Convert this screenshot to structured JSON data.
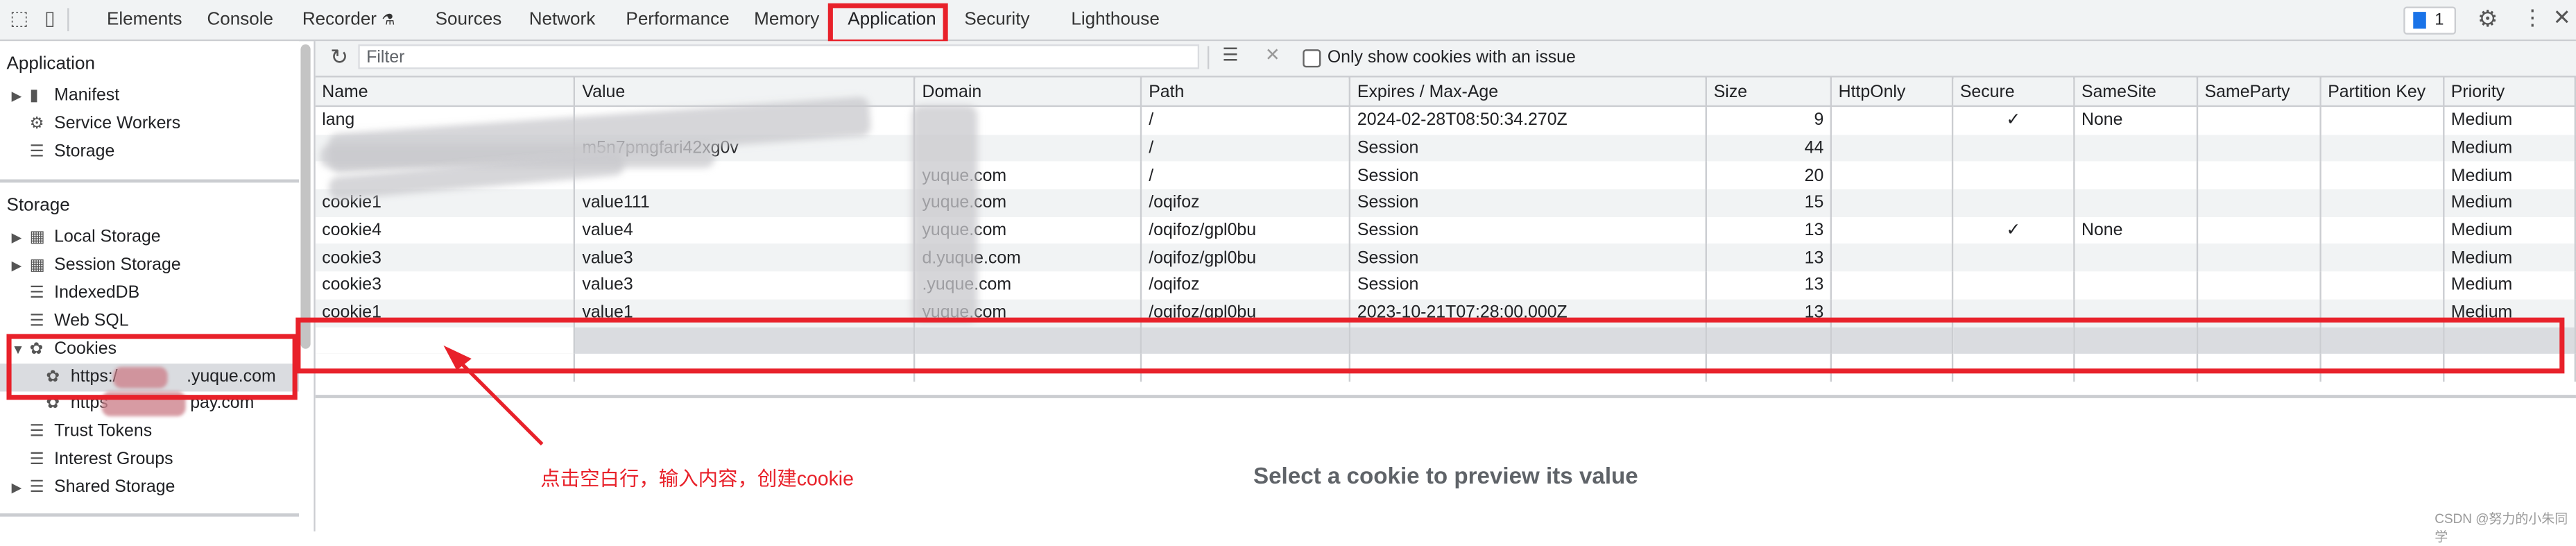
{
  "topbar": {
    "tabs": [
      "Elements",
      "Console",
      "Recorder",
      "Sources",
      "Network",
      "Performance",
      "Memory",
      "Application",
      "Security",
      "Lighthouse"
    ],
    "active_tab": "Application",
    "issues_count": "1",
    "icons": [
      "inspect-icon",
      "device-toolbar-icon",
      "recorder-flask-icon",
      "issues-icon",
      "gear-icon",
      "more-vertical-icon",
      "close-icon"
    ]
  },
  "sidebar": {
    "application_header": "Application",
    "application_items": [
      {
        "label": "Manifest",
        "icon": "file-icon"
      },
      {
        "label": "Service Workers",
        "icon": "gear-icon"
      },
      {
        "label": "Storage",
        "icon": "database-icon"
      }
    ],
    "storage_header": "Storage",
    "storage_items": [
      {
        "label": "Local Storage",
        "icon": "grid-icon"
      },
      {
        "label": "Session Storage",
        "icon": "grid-icon"
      },
      {
        "label": "IndexedDB",
        "icon": "database-icon"
      },
      {
        "label": "Web SQL",
        "icon": "database-icon"
      },
      {
        "label": "Cookies",
        "icon": "cookie-icon"
      },
      {
        "label": "https:/",
        "label_suffix": ".yuque.com",
        "icon": "cookie-icon",
        "selected": true
      },
      {
        "label": "https",
        "label_suffix": "pay.com",
        "icon": "cookie-icon"
      },
      {
        "label": "Trust Tokens",
        "icon": "database-icon"
      },
      {
        "label": "Interest Groups",
        "icon": "database-icon"
      },
      {
        "label": "Shared Storage",
        "icon": "database-icon"
      }
    ]
  },
  "toolbar": {
    "filter_placeholder": "Filter",
    "filter_value": "",
    "only_issues_label": "Only show cookies with an issue",
    "only_issues_checked": false
  },
  "table": {
    "columns": [
      "Name",
      "Value",
      "Domain",
      "Path",
      "Expires / Max-Age",
      "Size",
      "HttpOnly",
      "Secure",
      "SameSite",
      "SameParty",
      "Partition Key",
      "Priority"
    ],
    "rows": [
      [
        "lang",
        "",
        "",
        "/",
        "2024-02-28T08:50:34.270Z",
        "9",
        "",
        "✓",
        "None",
        "",
        "",
        "Medium"
      ],
      [
        "",
        "m5n7pmgfari42xg0v",
        "",
        "/",
        "Session",
        "44",
        "",
        "",
        "",
        "",
        "",
        "Medium"
      ],
      [
        "",
        "",
        "yuque.com",
        "/",
        "Session",
        "20",
        "",
        "",
        "",
        "",
        "",
        "Medium"
      ],
      [
        "cookie1",
        "value111",
        "yuque.com",
        "/oqifoz",
        "Session",
        "15",
        "",
        "",
        "",
        "",
        "",
        "Medium"
      ],
      [
        "cookie4",
        "value4",
        "yuque.com",
        "/oqifoz/gpl0bu",
        "Session",
        "13",
        "",
        "✓",
        "None",
        "",
        "",
        "Medium"
      ],
      [
        "cookie3",
        "value3",
        "d.yuque.com",
        "/oqifoz/gpl0bu",
        "Session",
        "13",
        "",
        "",
        "",
        "",
        "",
        "Medium"
      ],
      [
        "cookie3",
        "value3",
        ".yuque.com",
        "/oqifoz",
        "Session",
        "13",
        "",
        "",
        "",
        "",
        "",
        "Medium"
      ],
      [
        "cookie1",
        "value1",
        "yuque.com",
        "/oqifoz/gpl0bu",
        "2023-10-21T07:28:00.000Z",
        "13",
        "",
        "",
        "",
        "",
        "",
        "Medium"
      ]
    ]
  },
  "preview": {
    "empty_text": "Select a cookie to preview its value"
  },
  "annotation": {
    "text": "点击空白行，输入内容，创建cookie",
    "color": "#e8212a"
  },
  "watermark": "CSDN @努力的小朱同学"
}
